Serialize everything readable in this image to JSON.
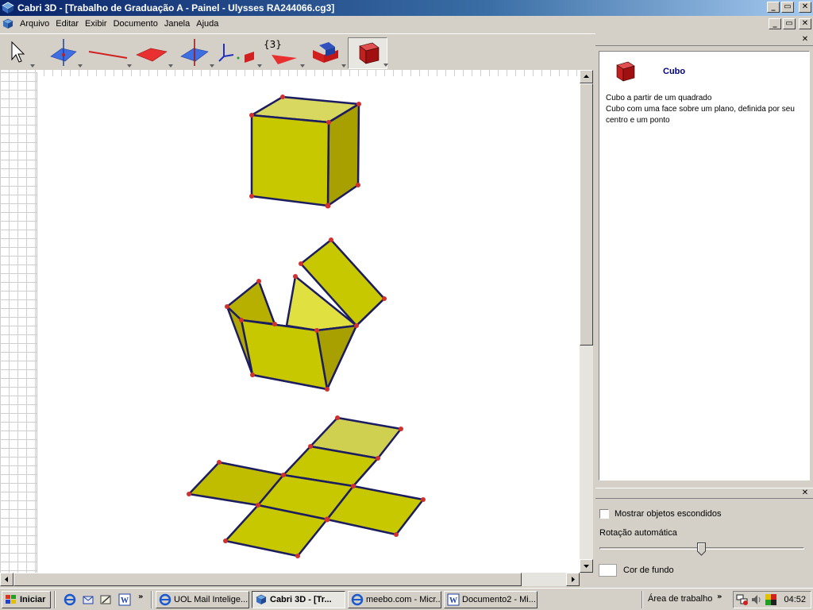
{
  "window": {
    "title": "Cabri 3D - [Trabalho de Graduação A - Painel - Ulysses RA244066.cg3]",
    "controls": {
      "minimize": "_",
      "maximize": "▭",
      "close": "✕"
    }
  },
  "menubar": {
    "items": [
      "Arquivo",
      "Editar",
      "Exibir",
      "Documento",
      "Janela",
      "Ajuda"
    ]
  },
  "toolbar": {
    "tools": [
      {
        "name": "pointer-tool",
        "icon": "arrow-pointer-icon"
      },
      {
        "name": "point-tool",
        "icon": "point-on-plane-icon"
      },
      {
        "name": "line-tool",
        "icon": "line-icon"
      },
      {
        "name": "surface-tool",
        "icon": "plane-icon"
      },
      {
        "name": "perpendicular-tool",
        "icon": "perpendicular-icon"
      },
      {
        "name": "transformation-tool",
        "icon": "axes-icon"
      },
      {
        "name": "measurement-tool",
        "icon": "measure-icon",
        "label": "{3}"
      },
      {
        "name": "unfold-tool",
        "icon": "unfold-icon"
      },
      {
        "name": "polyhedron-tool",
        "icon": "cube-icon",
        "active": true
      }
    ]
  },
  "help_panel": {
    "title": "Cubo",
    "lines": [
      "Cubo a partir de um quadrado",
      "Cubo com uma face sobre um plano, definida por seu centro e um ponto"
    ]
  },
  "view_panel": {
    "show_hidden_label": "Mostrar objetos escondidos",
    "show_hidden_checked": false,
    "auto_rotation_label": "Rotação automática",
    "auto_rotation_value": 0.5,
    "background_color_label": "Cor de fundo",
    "background_color": "#ffffff"
  },
  "taskbar": {
    "start_label": "Iniciar",
    "chevron": "»",
    "tasks": [
      {
        "label": "UOL Mail Intelige...",
        "icon": "ie-icon",
        "active": false
      },
      {
        "label": "Cabri 3D - [Tr...",
        "icon": "cabri-icon",
        "active": true
      },
      {
        "label": "meebo.com - Micr...",
        "icon": "ie-icon",
        "active": false
      },
      {
        "label": "Documento2 - Mi...",
        "icon": "word-icon",
        "active": false
      }
    ],
    "desktop_label": "Área de trabalho",
    "clock": "04:52"
  },
  "colors": {
    "face_front": "#c8c800",
    "face_side": "#a8a000",
    "face_top": "#d8d860",
    "edge": "#1c1c60",
    "vertex": "#d03030",
    "title_gradient_start": "#0a246a"
  }
}
